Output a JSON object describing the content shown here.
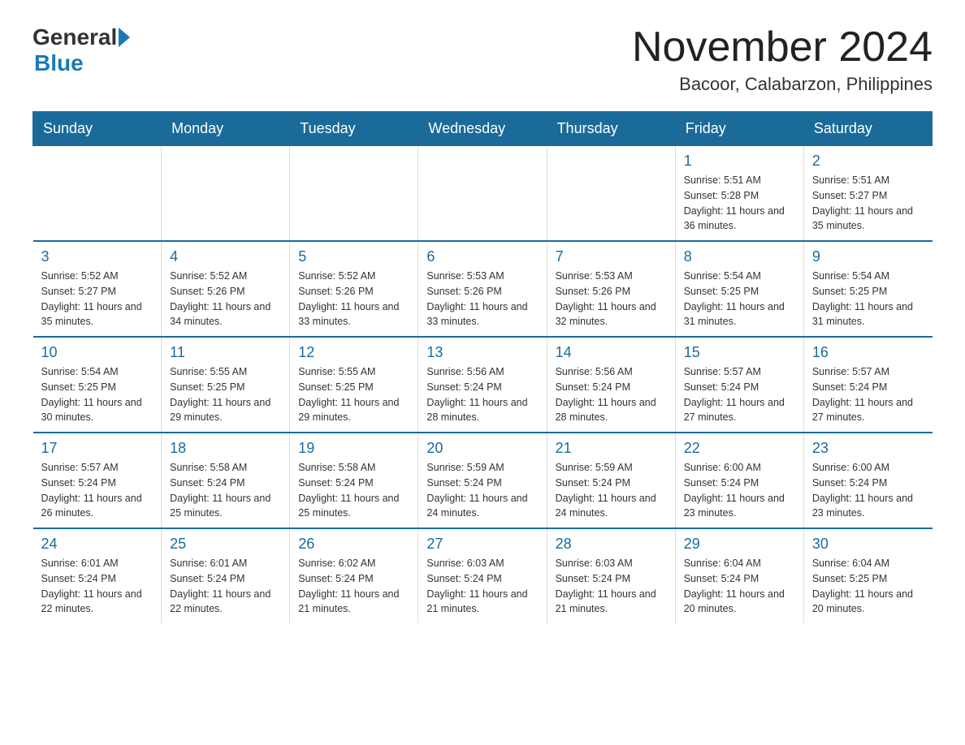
{
  "logo": {
    "general": "General",
    "blue": "Blue"
  },
  "header": {
    "title": "November 2024",
    "subtitle": "Bacoor, Calabarzon, Philippines"
  },
  "weekdays": [
    "Sunday",
    "Monday",
    "Tuesday",
    "Wednesday",
    "Thursday",
    "Friday",
    "Saturday"
  ],
  "weeks": [
    [
      {
        "day": "",
        "info": ""
      },
      {
        "day": "",
        "info": ""
      },
      {
        "day": "",
        "info": ""
      },
      {
        "day": "",
        "info": ""
      },
      {
        "day": "",
        "info": ""
      },
      {
        "day": "1",
        "info": "Sunrise: 5:51 AM\nSunset: 5:28 PM\nDaylight: 11 hours and 36 minutes."
      },
      {
        "day": "2",
        "info": "Sunrise: 5:51 AM\nSunset: 5:27 PM\nDaylight: 11 hours and 35 minutes."
      }
    ],
    [
      {
        "day": "3",
        "info": "Sunrise: 5:52 AM\nSunset: 5:27 PM\nDaylight: 11 hours and 35 minutes."
      },
      {
        "day": "4",
        "info": "Sunrise: 5:52 AM\nSunset: 5:26 PM\nDaylight: 11 hours and 34 minutes."
      },
      {
        "day": "5",
        "info": "Sunrise: 5:52 AM\nSunset: 5:26 PM\nDaylight: 11 hours and 33 minutes."
      },
      {
        "day": "6",
        "info": "Sunrise: 5:53 AM\nSunset: 5:26 PM\nDaylight: 11 hours and 33 minutes."
      },
      {
        "day": "7",
        "info": "Sunrise: 5:53 AM\nSunset: 5:26 PM\nDaylight: 11 hours and 32 minutes."
      },
      {
        "day": "8",
        "info": "Sunrise: 5:54 AM\nSunset: 5:25 PM\nDaylight: 11 hours and 31 minutes."
      },
      {
        "day": "9",
        "info": "Sunrise: 5:54 AM\nSunset: 5:25 PM\nDaylight: 11 hours and 31 minutes."
      }
    ],
    [
      {
        "day": "10",
        "info": "Sunrise: 5:54 AM\nSunset: 5:25 PM\nDaylight: 11 hours and 30 minutes."
      },
      {
        "day": "11",
        "info": "Sunrise: 5:55 AM\nSunset: 5:25 PM\nDaylight: 11 hours and 29 minutes."
      },
      {
        "day": "12",
        "info": "Sunrise: 5:55 AM\nSunset: 5:25 PM\nDaylight: 11 hours and 29 minutes."
      },
      {
        "day": "13",
        "info": "Sunrise: 5:56 AM\nSunset: 5:24 PM\nDaylight: 11 hours and 28 minutes."
      },
      {
        "day": "14",
        "info": "Sunrise: 5:56 AM\nSunset: 5:24 PM\nDaylight: 11 hours and 28 minutes."
      },
      {
        "day": "15",
        "info": "Sunrise: 5:57 AM\nSunset: 5:24 PM\nDaylight: 11 hours and 27 minutes."
      },
      {
        "day": "16",
        "info": "Sunrise: 5:57 AM\nSunset: 5:24 PM\nDaylight: 11 hours and 27 minutes."
      }
    ],
    [
      {
        "day": "17",
        "info": "Sunrise: 5:57 AM\nSunset: 5:24 PM\nDaylight: 11 hours and 26 minutes."
      },
      {
        "day": "18",
        "info": "Sunrise: 5:58 AM\nSunset: 5:24 PM\nDaylight: 11 hours and 25 minutes."
      },
      {
        "day": "19",
        "info": "Sunrise: 5:58 AM\nSunset: 5:24 PM\nDaylight: 11 hours and 25 minutes."
      },
      {
        "day": "20",
        "info": "Sunrise: 5:59 AM\nSunset: 5:24 PM\nDaylight: 11 hours and 24 minutes."
      },
      {
        "day": "21",
        "info": "Sunrise: 5:59 AM\nSunset: 5:24 PM\nDaylight: 11 hours and 24 minutes."
      },
      {
        "day": "22",
        "info": "Sunrise: 6:00 AM\nSunset: 5:24 PM\nDaylight: 11 hours and 23 minutes."
      },
      {
        "day": "23",
        "info": "Sunrise: 6:00 AM\nSunset: 5:24 PM\nDaylight: 11 hours and 23 minutes."
      }
    ],
    [
      {
        "day": "24",
        "info": "Sunrise: 6:01 AM\nSunset: 5:24 PM\nDaylight: 11 hours and 22 minutes."
      },
      {
        "day": "25",
        "info": "Sunrise: 6:01 AM\nSunset: 5:24 PM\nDaylight: 11 hours and 22 minutes."
      },
      {
        "day": "26",
        "info": "Sunrise: 6:02 AM\nSunset: 5:24 PM\nDaylight: 11 hours and 21 minutes."
      },
      {
        "day": "27",
        "info": "Sunrise: 6:03 AM\nSunset: 5:24 PM\nDaylight: 11 hours and 21 minutes."
      },
      {
        "day": "28",
        "info": "Sunrise: 6:03 AM\nSunset: 5:24 PM\nDaylight: 11 hours and 21 minutes."
      },
      {
        "day": "29",
        "info": "Sunrise: 6:04 AM\nSunset: 5:24 PM\nDaylight: 11 hours and 20 minutes."
      },
      {
        "day": "30",
        "info": "Sunrise: 6:04 AM\nSunset: 5:25 PM\nDaylight: 11 hours and 20 minutes."
      }
    ]
  ]
}
